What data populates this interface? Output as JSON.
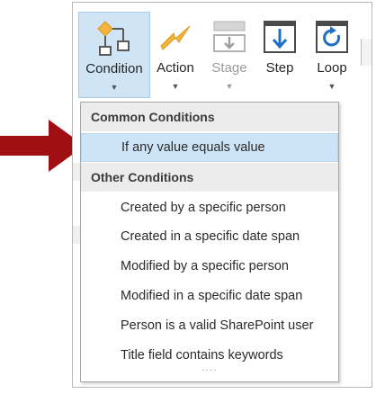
{
  "ribbon": {
    "buttons": [
      {
        "label": "Condition",
        "icon": "condition-flowchart-icon",
        "state": "pressed"
      },
      {
        "label": "Action",
        "icon": "lightning-bolt-icon",
        "state": "normal"
      },
      {
        "label": "Stage",
        "icon": "stage-icon",
        "state": "disabled"
      },
      {
        "label": "Step",
        "icon": "step-down-arrow-icon",
        "state": "normal"
      },
      {
        "label": "Loop",
        "icon": "loop-refresh-icon",
        "state": "normal"
      }
    ]
  },
  "dropdown": {
    "sections": [
      {
        "header": "Common Conditions",
        "items": [
          "If any value equals value"
        ]
      },
      {
        "header": "Other Conditions",
        "items": [
          "Created by a specific person",
          "Created in a specific date span",
          "Modified by a specific person",
          "Modified in a specific date span",
          "Person is a valid SharePoint user",
          "Title field contains keywords"
        ]
      }
    ],
    "selected_item": "If any value equals value",
    "resize_grip": "····"
  },
  "colors": {
    "accent_blue": "#cfe4f5",
    "selected_item_bg": "#cde4f7",
    "section_header_bg": "#ececec",
    "pointer_arrow": "#a00f14"
  }
}
